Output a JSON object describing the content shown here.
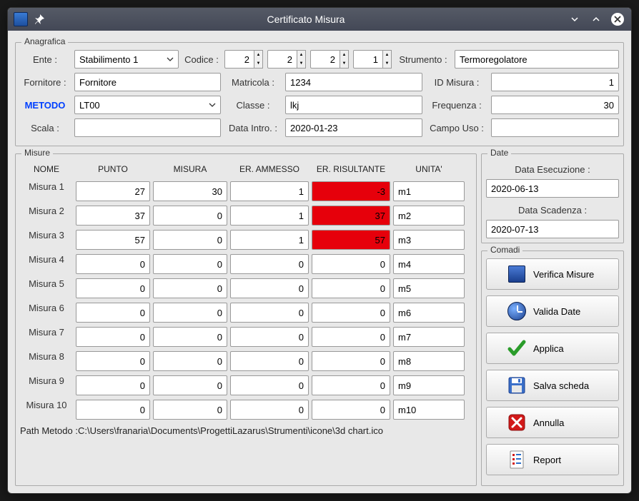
{
  "window": {
    "title": "Certificato Misura"
  },
  "anagrafica": {
    "group_title": "Anagrafica",
    "ente_label": "Ente :",
    "ente_value": "Stabilimento 1",
    "codice_label": "Codice :",
    "codice": [
      "2",
      "2",
      "2",
      "1"
    ],
    "strumento_label": "Strumento :",
    "strumento_value": "Termoregolatore",
    "fornitore_label": "Fornitore :",
    "fornitore_value": "Fornitore",
    "matricola_label": "Matricola :",
    "matricola_value": "1234",
    "idmisura_label": "ID Misura :",
    "idmisura_value": "1",
    "metodo_label": "METODO",
    "metodo_value": "LT00",
    "classe_label": "Classe :",
    "classe_value": "lkj",
    "frequenza_label": "Frequenza :",
    "frequenza_value": "30",
    "scala_label": "Scala :",
    "scala_value": "",
    "dataintro_label": "Data Intro. :",
    "dataintro_value": "2020-01-23",
    "campouso_label": "Campo Uso :",
    "campouso_value": ""
  },
  "misure": {
    "group_title": "Misure",
    "headers": {
      "nome": "NOME",
      "punto": "PUNTO",
      "misura": "MISURA",
      "erammesso": "ER. AMMESSO",
      "errisultante": "ER. RISULTANTE",
      "unita": "UNITA'"
    },
    "rows": [
      {
        "nome": "Misura 1",
        "punto": "27",
        "misura": "30",
        "ea": "1",
        "er": "-3",
        "unita": "m1",
        "red": true
      },
      {
        "nome": "Misura 2",
        "punto": "37",
        "misura": "0",
        "ea": "1",
        "er": "37",
        "unita": "m2",
        "red": true
      },
      {
        "nome": "Misura 3",
        "punto": "57",
        "misura": "0",
        "ea": "1",
        "er": "57",
        "unita": "m3",
        "red": true
      },
      {
        "nome": "Misura 4",
        "punto": "0",
        "misura": "0",
        "ea": "0",
        "er": "0",
        "unita": "m4",
        "red": false
      },
      {
        "nome": "Misura 5",
        "punto": "0",
        "misura": "0",
        "ea": "0",
        "er": "0",
        "unita": "m5",
        "red": false
      },
      {
        "nome": "Misura 6",
        "punto": "0",
        "misura": "0",
        "ea": "0",
        "er": "0",
        "unita": "m6",
        "red": false
      },
      {
        "nome": "Misura 7",
        "punto": "0",
        "misura": "0",
        "ea": "0",
        "er": "0",
        "unita": "m7",
        "red": false
      },
      {
        "nome": "Misura 8",
        "punto": "0",
        "misura": "0",
        "ea": "0",
        "er": "0",
        "unita": "m8",
        "red": false
      },
      {
        "nome": "Misura 9",
        "punto": "0",
        "misura": "0",
        "ea": "0",
        "er": "0",
        "unita": "m9",
        "red": false
      },
      {
        "nome": "Misura 10",
        "punto": "0",
        "misura": "0",
        "ea": "0",
        "er": "0",
        "unita": "m10",
        "red": false
      }
    ],
    "path_label": "Path Metodo :",
    "path_value": "C:\\Users\\franaria\\Documents\\ProgettiLazarus\\Strumenti\\icone\\3d chart.ico"
  },
  "date": {
    "group_title": "Date",
    "esec_label": "Data Esecuzione :",
    "esec_value": "2020-06-13",
    "scad_label": "Data Scadenza :",
    "scad_value": "2020-07-13"
  },
  "comandi": {
    "group_title": "Comadi",
    "verifica": "Verifica Misure",
    "valida": "Valida Date",
    "applica": "Applica",
    "salva": "Salva scheda",
    "annulla": "Annulla",
    "report": "Report"
  }
}
